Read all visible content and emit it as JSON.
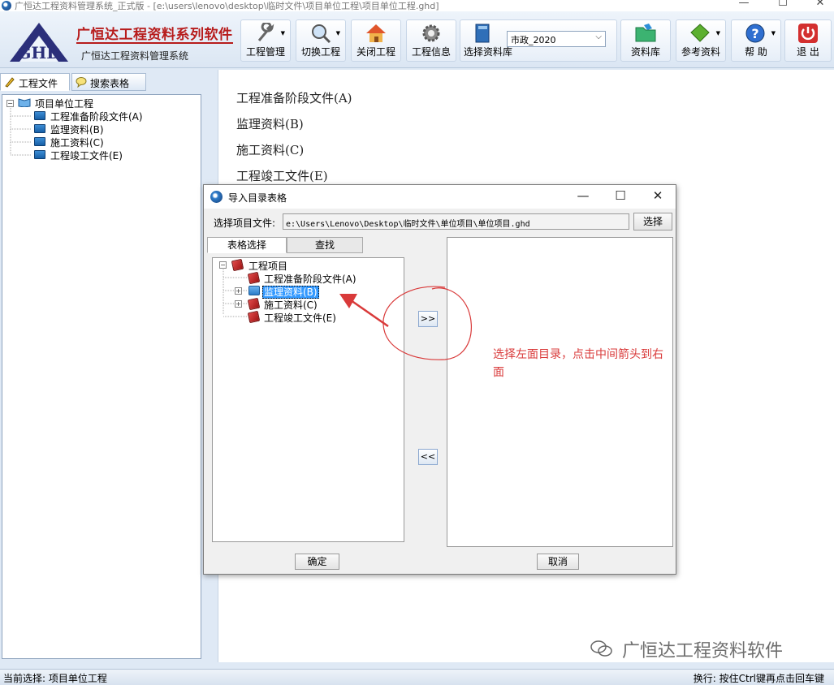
{
  "window": {
    "title": "广恒达工程资料管理系统_正式版 - [e:\\users\\lenovo\\desktop\\临时文件\\项目单位工程\\项目单位工程.ghd]",
    "minimize": "—",
    "maximize": "☐",
    "close": "✕"
  },
  "brand": {
    "title": "广恒达工程资料系列软件",
    "subtitle": "广恒达工程资料管理系统"
  },
  "toolbar": {
    "project_manage": "工程管理",
    "switch_project": "切换工程",
    "close_project": "关闭工程",
    "project_info": "工程信息",
    "select_library": "选择资料库",
    "library_value": "市政_2020",
    "library": "资料库",
    "reference": "参考资料",
    "help": "帮 助",
    "exit": "退 出"
  },
  "left_tabs": {
    "project_files": "工程文件",
    "search_tables": "搜索表格"
  },
  "left_tree": {
    "root": "项目单位工程",
    "items": [
      "工程准备阶段文件(A)",
      "监理资料(B)",
      "施工资料(C)",
      "工程竣工文件(E)"
    ]
  },
  "right_pane": {
    "items": [
      "工程准备阶段文件(A)",
      "监理资料(B)",
      "施工资料(C)",
      "工程竣工文件(E)"
    ]
  },
  "dialog": {
    "title": "导入目录表格",
    "file_label": "选择项目文件:",
    "file_path": "e:\\Users\\Lenovo\\Desktop\\临时文件\\单位项目\\单位项目.ghd",
    "pick_button": "选择",
    "tab_select": "表格选择",
    "tab_find": "查找",
    "tree_root": "工程项目",
    "tree_items": [
      "工程准备阶段文件(A)",
      "监理资料(B)",
      "施工资料(C)",
      "工程竣工文件(E)"
    ],
    "move_right": ">>",
    "move_left": "<<",
    "ok": "确定",
    "cancel": "取消"
  },
  "annotation": {
    "text": "选择左面目录，点击中间箭头到右面",
    "color": "#d93a3a"
  },
  "watermark": "广恒达工程资料软件",
  "status": {
    "current": "当前选择: 项目单位工程",
    "hint": "换行: 按住Ctrl键再点击回车键"
  }
}
